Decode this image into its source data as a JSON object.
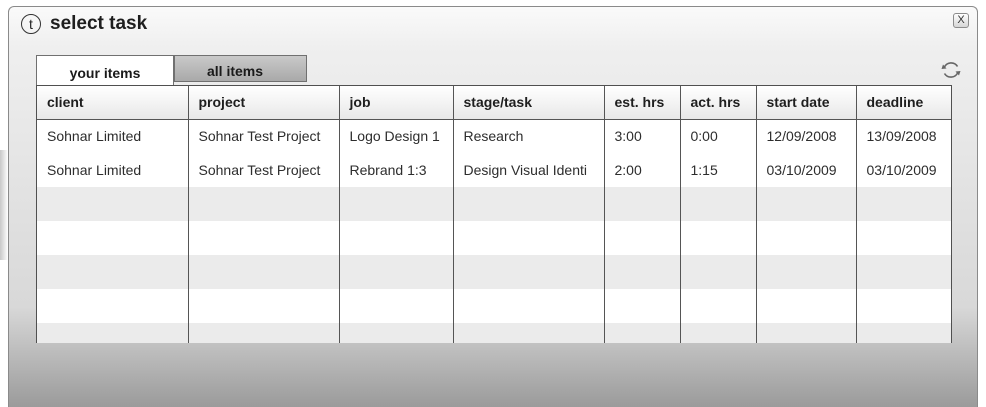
{
  "window": {
    "logo_letter": "t",
    "title": "select task",
    "close_label": "X"
  },
  "tabs": [
    {
      "label": "your items",
      "active": true
    },
    {
      "label": "all items",
      "active": false
    }
  ],
  "table": {
    "columns": [
      "client",
      "project",
      "job",
      "stage/task",
      "est. hrs",
      "act. hrs",
      "start date",
      "deadline"
    ],
    "rows": [
      [
        "Sohnar Limited",
        "Sohnar Test Project",
        "Logo Design 1",
        "Research",
        "3:00",
        "0:00",
        "12/09/2008",
        "13/09/2008"
      ],
      [
        "Sohnar Limited",
        "Sohnar Test Project",
        "Rebrand 1:3",
        "Design Visual Identi",
        "2:00",
        "1:15",
        "03/10/2009",
        "03/10/2009"
      ]
    ]
  },
  "icons": {
    "logo": "t-circle-logo-icon",
    "close": "close-icon",
    "refresh": "refresh-icon"
  },
  "colors": {
    "grid_border": "#505050",
    "row_alt": "#ebebeb",
    "tab_inactive": "#b9b9b9"
  }
}
